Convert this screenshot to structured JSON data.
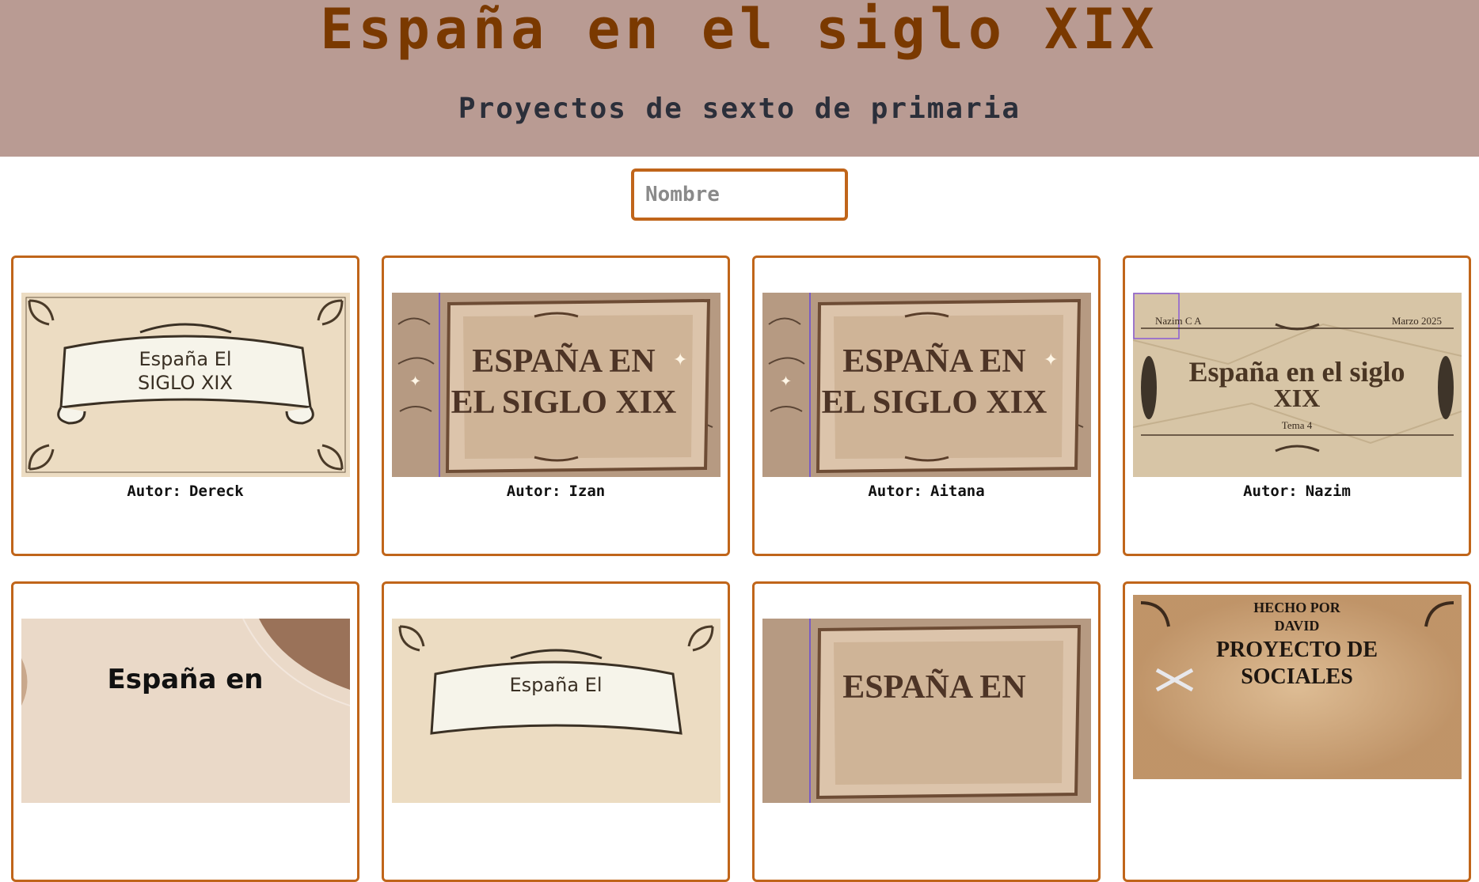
{
  "header": {
    "title": "España en el siglo XIX",
    "subtitle": "Proyectos de sexto de primaria"
  },
  "search": {
    "placeholder": "Nombre",
    "value": ""
  },
  "author_prefix": "Autor:",
  "projects": [
    {
      "author": "Dereck",
      "thumb": {
        "style": "scroll",
        "line1": "España El",
        "line2": "SIGLO XIX"
      }
    },
    {
      "author": "Izan",
      "thumb": {
        "style": "parchment",
        "line1": "ESPAÑA EN",
        "line2": "EL SIGLO XIX"
      }
    },
    {
      "author": "Aitana",
      "thumb": {
        "style": "parchment",
        "line1": "ESPAÑA EN",
        "line2": "EL SIGLO XIX"
      }
    },
    {
      "author": "Nazim",
      "thumb": {
        "style": "crumpled",
        "top_left": "Nazim C A",
        "top_right": "Marzo 2025",
        "line1": "España en el siglo",
        "line2": "XIX",
        "line3": "Tema 4"
      }
    },
    {
      "author": "",
      "thumb": {
        "style": "modern",
        "line1": "España en"
      }
    },
    {
      "author": "",
      "thumb": {
        "style": "scroll",
        "line1": "España El",
        "line2": ""
      }
    },
    {
      "author": "",
      "thumb": {
        "style": "parchment",
        "line1": "ESPAÑA EN",
        "line2": ""
      }
    },
    {
      "author": "",
      "thumb": {
        "style": "ornate",
        "line1": "HECHO POR",
        "line2": "DAVID",
        "line3": "PROYECTO DE",
        "line4": "SOCIALES"
      }
    }
  ]
}
